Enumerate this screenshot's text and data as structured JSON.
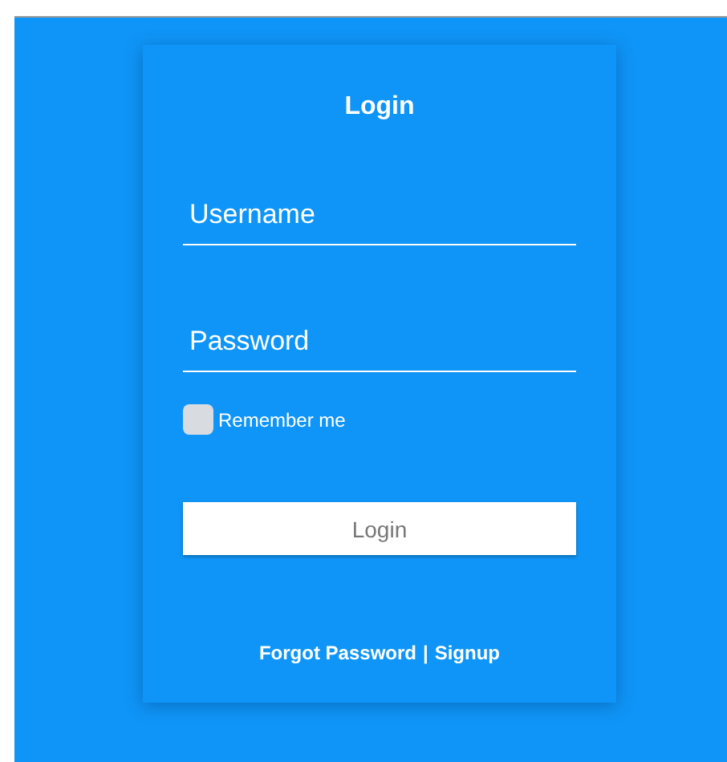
{
  "title": "Login",
  "fields": [
    {
      "placeholder": "Username"
    },
    {
      "placeholder": "Password"
    }
  ],
  "remember": {
    "label": "Remember me",
    "checked": false
  },
  "submit": "Login",
  "footer": {
    "links": [
      "Forgot Password",
      "Signup"
    ],
    "separator": "|"
  }
}
